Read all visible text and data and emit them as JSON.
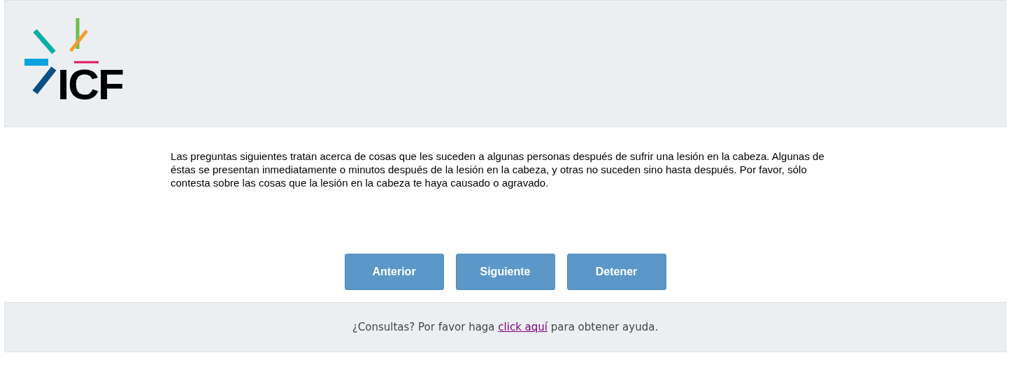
{
  "header": {
    "logo_text": "ICF"
  },
  "intro": "Las preguntas siguientes tratan acerca de cosas que les suceden a algunas personas después de sufrir una lesión en la cabeza. Algunas de éstas se presentan inmediatamente o minutos después de la lesión en la cabeza, y otras no suceden sino hasta después. Por favor, sólo contesta sobre las cosas que la lesión en la cabeza te haya causado o agravado.",
  "buttons": [
    "Anterior",
    "Siguiente",
    "Detener"
  ],
  "footer": {
    "text_before": "¿Consultas? Por favor haga",
    "link": "click aquí",
    "text_after": "para obtener ayuda."
  }
}
